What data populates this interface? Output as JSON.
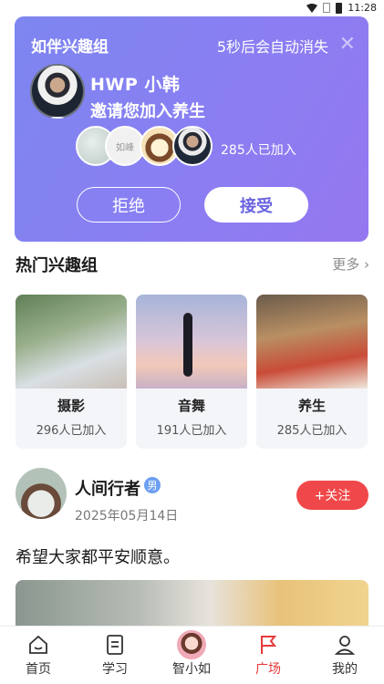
{
  "status_bar": {
    "time": "11:28"
  },
  "invite": {
    "title": "如伴兴趣组",
    "countdown": "5秒后会自动消失",
    "inviter_name": "HWP  小韩",
    "message": "邀请您加入养生",
    "member_mid_label": "如峰",
    "joined_count": "285人已加入",
    "reject_label": "拒绝",
    "accept_label": "接受",
    "close_icon": "close-icon"
  },
  "hot_groups": {
    "title": "热门兴趣组",
    "more_label": "更多",
    "items": [
      {
        "name": "摄影",
        "count": "296人已加入"
      },
      {
        "name": "音舞",
        "count": "191人已加入"
      },
      {
        "name": "养生",
        "count": "285人已加入"
      }
    ]
  },
  "post": {
    "author": "人间行者",
    "gender": "男",
    "date": "2025年05月14日",
    "follow_label": "+关注",
    "text": "希望大家都平安顺意。"
  },
  "tabbar": {
    "items": [
      {
        "label": "首页",
        "icon": "home-icon"
      },
      {
        "label": "学习",
        "icon": "book-icon"
      },
      {
        "label": "智小如",
        "icon": "assistant-avatar"
      },
      {
        "label": "广场",
        "icon": "flag-icon"
      },
      {
        "label": "我的",
        "icon": "user-icon"
      }
    ],
    "active_index": 3,
    "active_color": "#e8393b"
  },
  "colors": {
    "card_gradient_start": "#7d86f0",
    "card_gradient_end": "#9577f0",
    "follow_button": "#f0484a",
    "gender_badge": "#6d9ff2"
  }
}
